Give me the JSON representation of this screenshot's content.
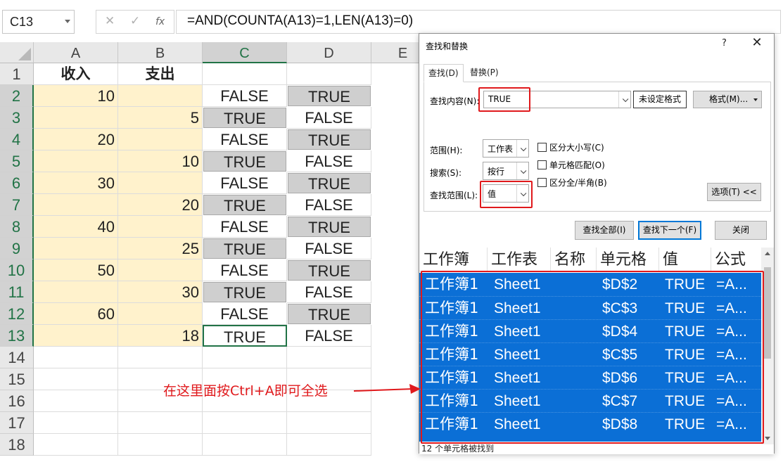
{
  "formula_bar": {
    "name_box": "C13",
    "cancel_icon": "✕",
    "enter_icon": "✓",
    "fx_label": "fx",
    "formula": "=AND(COUNTA(A13)=1,LEN(A13)=0)"
  },
  "columns": [
    "A",
    "B",
    "C",
    "D",
    "E"
  ],
  "rows": [
    "1",
    "2",
    "3",
    "4",
    "5",
    "6",
    "7",
    "8",
    "9",
    "10",
    "11",
    "12",
    "13",
    "14",
    "15",
    "16",
    "17",
    "18"
  ],
  "sheet": {
    "header_a": "收入",
    "header_b": "支出",
    "income": [
      "10",
      "",
      "20",
      "",
      "30",
      "",
      "40",
      "",
      "50",
      "",
      "60",
      ""
    ],
    "expense": [
      "",
      "5",
      "",
      "10",
      "",
      "20",
      "",
      "25",
      "",
      "30",
      "",
      "18"
    ],
    "col_c": [
      "FALSE",
      "TRUE",
      "FALSE",
      "TRUE",
      "FALSE",
      "TRUE",
      "FALSE",
      "TRUE",
      "FALSE",
      "TRUE",
      "FALSE",
      "TRUE"
    ],
    "col_d": [
      "TRUE",
      "FALSE",
      "TRUE",
      "FALSE",
      "TRUE",
      "FALSE",
      "TRUE",
      "FALSE",
      "TRUE",
      "FALSE",
      "TRUE",
      "FALSE"
    ]
  },
  "dialog": {
    "title": "查找和替换",
    "help": "?",
    "close": "✕",
    "tab_find": "查找(D)",
    "tab_replace": "替换(P)",
    "find_label": "查找内容(N):",
    "find_value": "TRUE",
    "no_format_button": "未设定格式",
    "format_button": "格式(M)...",
    "scope_label": "范围(H):",
    "scope_value": "工作表",
    "search_label": "搜索(S):",
    "search_value": "按行",
    "lookin_label": "查找范围(L):",
    "lookin_value": "值",
    "match_case": "区分大小写(C)",
    "match_cell": "单元格匹配(O)",
    "match_width": "区分全/半角(B)",
    "options_button": "选项(T) <<",
    "find_all_button": "查找全部(I)",
    "find_next_button": "查找下一个(F)",
    "close_button": "关闭"
  },
  "results": {
    "headers": [
      "工作簿",
      "工作表",
      "名称",
      "单元格",
      "值",
      "公式"
    ],
    "rows": [
      {
        "workbook": "工作簿1",
        "sheet": "Sheet1",
        "cell": "$D$2",
        "value": "TRUE",
        "formula": "=A..."
      },
      {
        "workbook": "工作簿1",
        "sheet": "Sheet1",
        "cell": "$C$3",
        "value": "TRUE",
        "formula": "=A..."
      },
      {
        "workbook": "工作簿1",
        "sheet": "Sheet1",
        "cell": "$D$4",
        "value": "TRUE",
        "formula": "=A..."
      },
      {
        "workbook": "工作簿1",
        "sheet": "Sheet1",
        "cell": "$C$5",
        "value": "TRUE",
        "formula": "=A..."
      },
      {
        "workbook": "工作簿1",
        "sheet": "Sheet1",
        "cell": "$D$6",
        "value": "TRUE",
        "formula": "=A..."
      },
      {
        "workbook": "工作簿1",
        "sheet": "Sheet1",
        "cell": "$C$7",
        "value": "TRUE",
        "formula": "=A..."
      },
      {
        "workbook": "工作簿1",
        "sheet": "Sheet1",
        "cell": "$D$8",
        "value": "TRUE",
        "formula": "=A..."
      }
    ],
    "status": "12 个单元格被找到"
  },
  "annotation": "在这里面按Ctrl+A即可全选",
  "colors": {
    "accent_green": "#217346",
    "highlight_red": "#e0191c",
    "selection_blue": "#0b6fd6",
    "input_yellow": "#fff2cc"
  }
}
